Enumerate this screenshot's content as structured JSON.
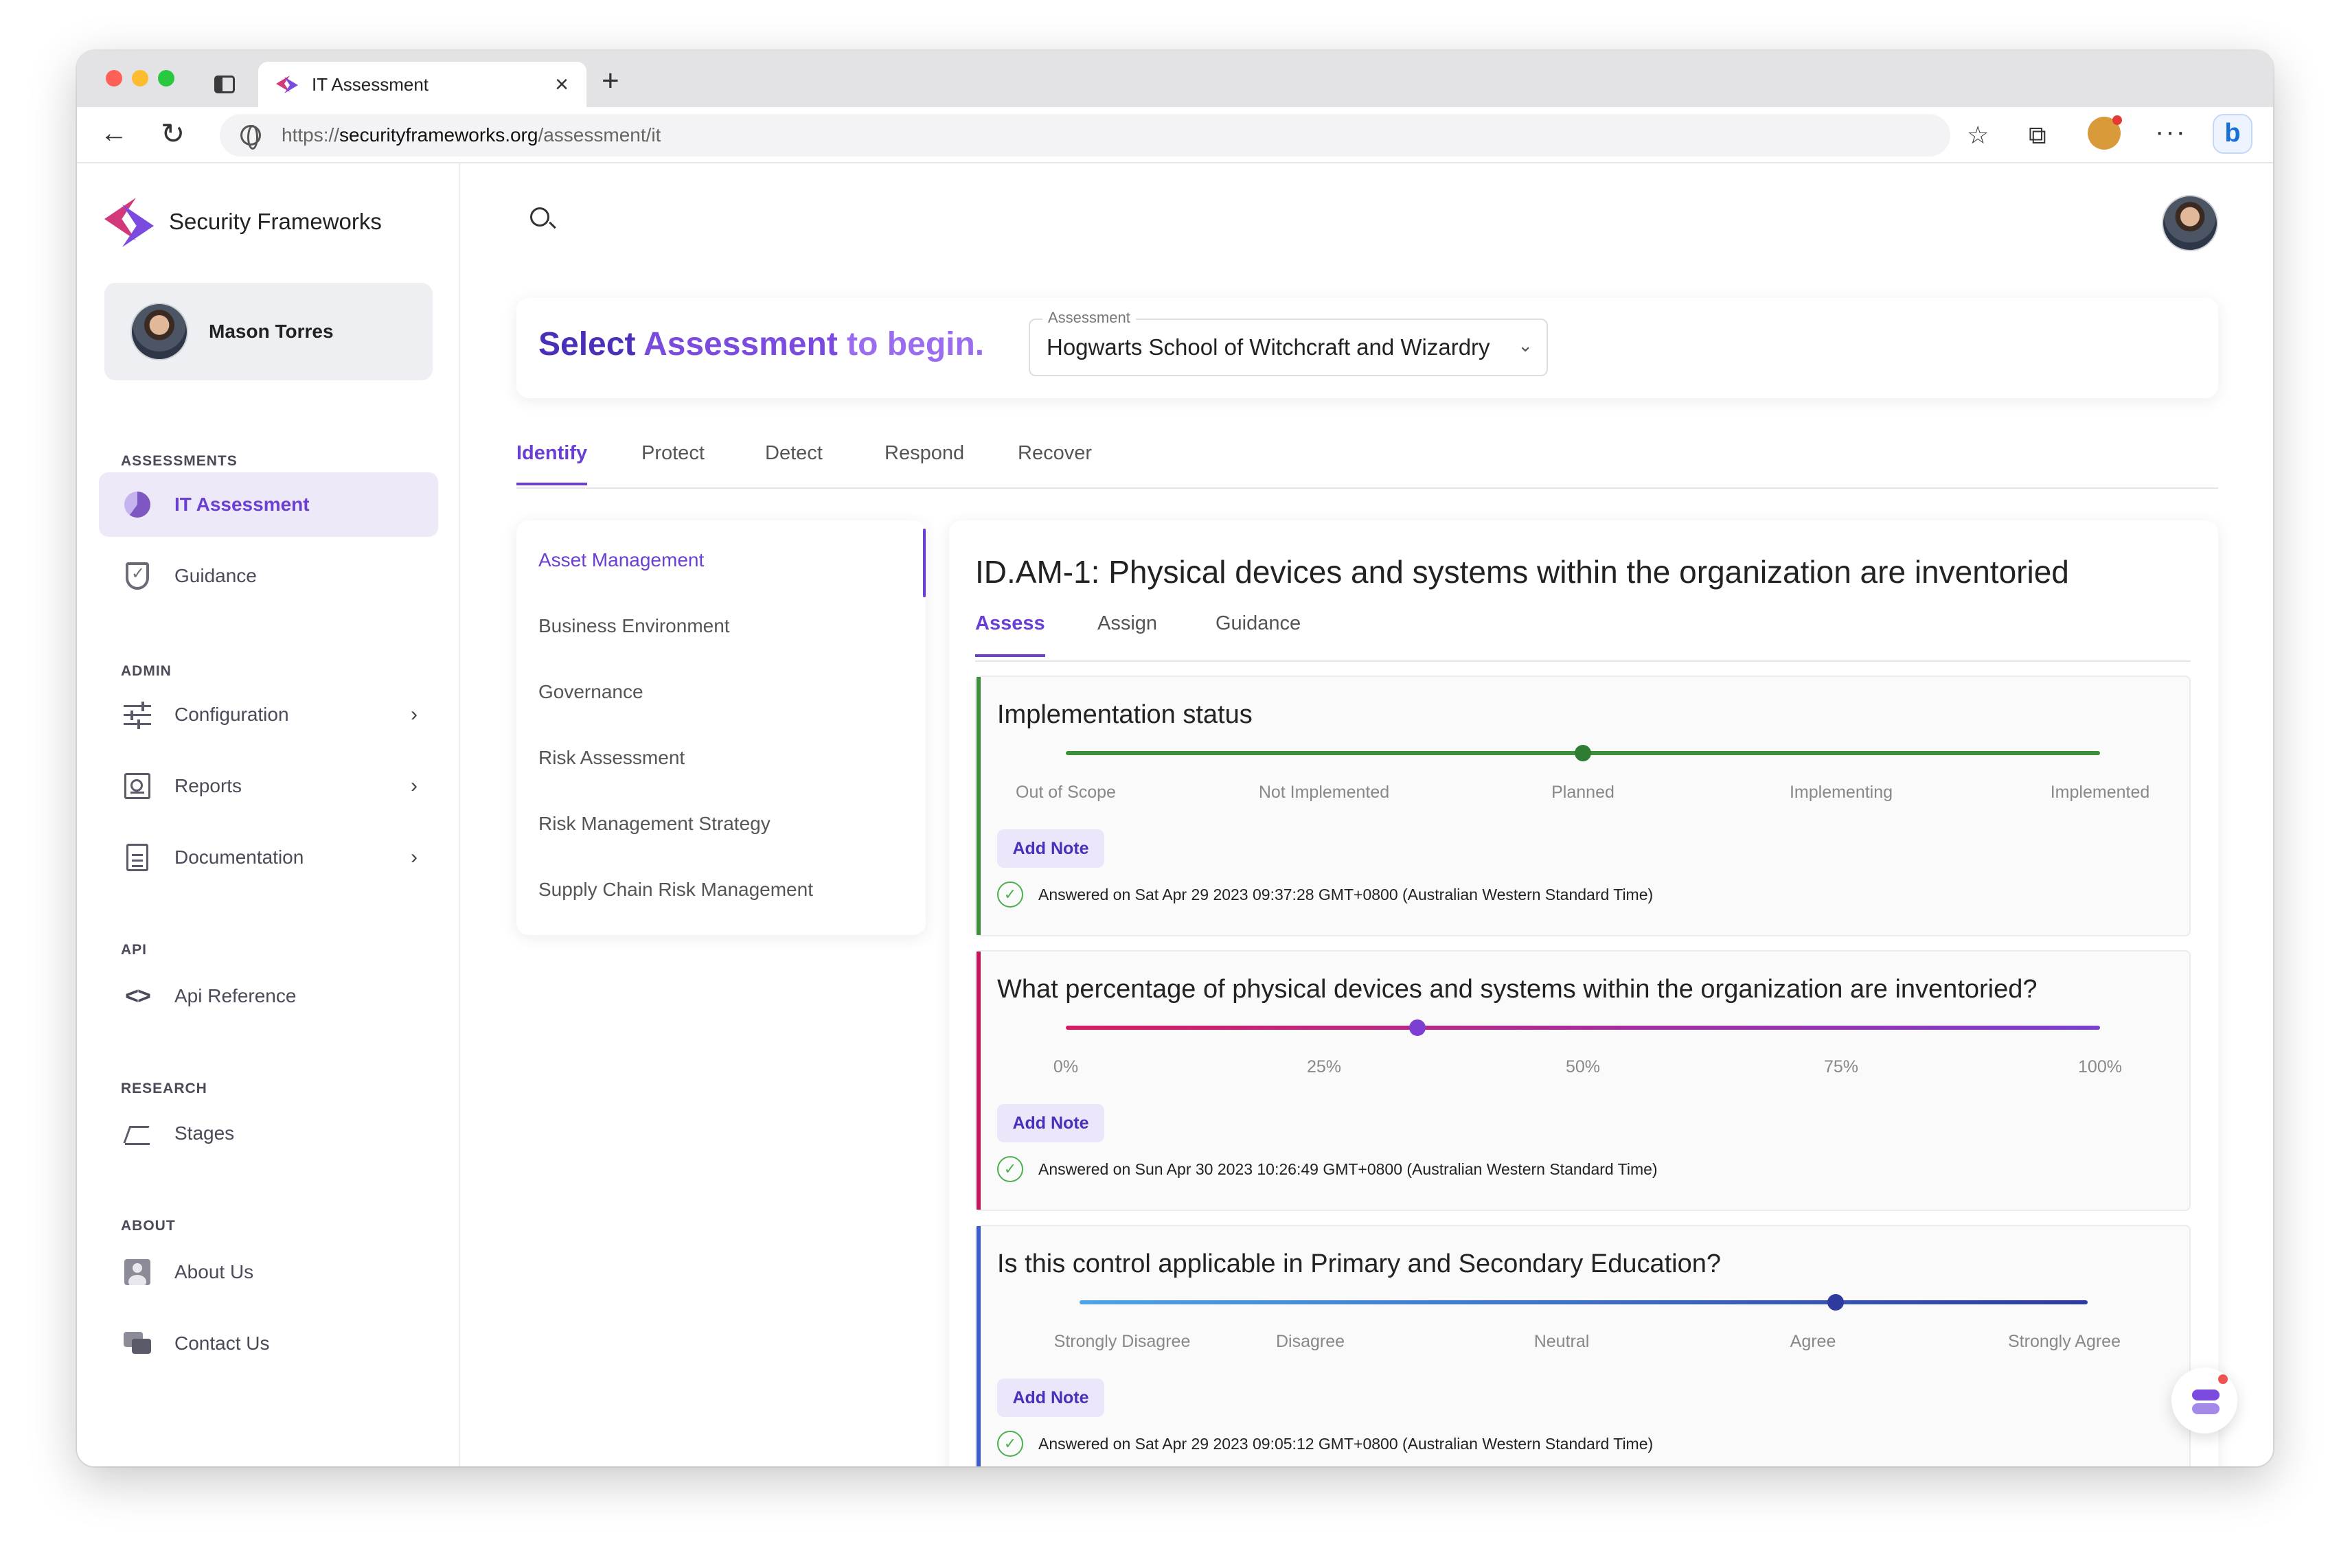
{
  "browser": {
    "tab_title": "IT Assessment",
    "url_prefix": "https://",
    "url_host": "securityframeworks.org",
    "url_path": "/assessment/it"
  },
  "sidebar": {
    "brand": "Security Frameworks",
    "user_name": "Mason Torres",
    "sections": {
      "assessments": "ASSESSMENTS",
      "admin": "ADMIN",
      "api": "API",
      "research": "RESEARCH",
      "about": "ABOUT"
    },
    "items": {
      "it_assessment": "IT Assessment",
      "guidance": "Guidance",
      "configuration": "Configuration",
      "reports": "Reports",
      "documentation": "Documentation",
      "api_reference": "Api Reference",
      "stages": "Stages",
      "about_us": "About Us",
      "contact_us": "Contact Us"
    }
  },
  "header": {
    "title_part1": "Select",
    "title_part2": "Assessment",
    "title_part3": "to begin.",
    "assessment_label": "Assessment",
    "assessment_value": "Hogwarts School of Witchcraft and Wizardry"
  },
  "main_tabs": [
    "Identify",
    "Protect",
    "Detect",
    "Respond",
    "Recover"
  ],
  "categories": [
    "Asset Management",
    "Business Environment",
    "Governance",
    "Risk Assessment",
    "Risk Management Strategy",
    "Supply Chain Risk Management"
  ],
  "detail": {
    "title": "ID.AM-1: Physical devices and systems within the organization are inventoried",
    "tabs": [
      "Assess",
      "Assign",
      "Guidance"
    ]
  },
  "questions": [
    {
      "title": "Implementation status",
      "labels": [
        "Out of Scope",
        "Not Implemented",
        "Planned",
        "Implementing",
        "Implemented"
      ],
      "value_fraction": 0.5,
      "note_button": "Add Note",
      "answered": "Answered on Sat Apr 29 2023 09:37:28 GMT+0800 (Australian Western Standard Time)",
      "accent": "#3f8f3a"
    },
    {
      "title": "What percentage of physical devices and systems within the organization are inventoried?",
      "labels": [
        "0%",
        "25%",
        "50%",
        "75%",
        "100%"
      ],
      "value_fraction": 0.34,
      "note_button": "Add Note",
      "answered": "Answered on Sun Apr 30 2023 10:26:49 GMT+0800 (Australian Western Standard Time)",
      "accent": "#c2185b"
    },
    {
      "title": "Is this control applicable in Primary and Secondary Education?",
      "labels": [
        "Strongly Disagree",
        "Disagree",
        "Neutral",
        "Agree",
        "Strongly Agree"
      ],
      "value_fraction": 0.75,
      "note_button": "Add Note",
      "answered": "Answered on Sat Apr 29 2023 09:05:12 GMT+0800 (Australian Western Standard Time)",
      "accent": "#3a5fc8"
    }
  ]
}
